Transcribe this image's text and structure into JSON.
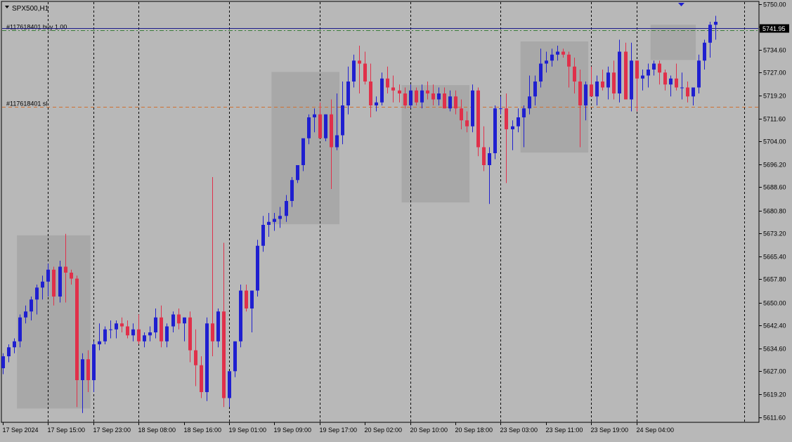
{
  "chart_data": {
    "type": "candlestick",
    "title": "SPX500,H1",
    "ylim": [
      5610.0,
      5751.0
    ],
    "y_ticks": [
      "5750.00",
      "5742.40",
      "5734.60",
      "5727.00",
      "5719.20",
      "5711.60",
      "5704.00",
      "5696.20",
      "5688.60",
      "5680.80",
      "5673.20",
      "5665.40",
      "5657.80",
      "5650.00",
      "5642.40",
      "5634.60",
      "5627.00",
      "5619.20",
      "5611.60"
    ],
    "x_labels": [
      "17 Sep 2024",
      "17 Sep 15:00",
      "17 Sep 23:00",
      "18 Sep 08:00",
      "18 Sep 16:00",
      "19 Sep 01:00",
      "19 Sep 09:00",
      "19 Sep 17:00",
      "20 Sep 02:00",
      "20 Sep 10:00",
      "20 Sep 18:00",
      "23 Sep 03:00",
      "23 Sep 11:00",
      "23 Sep 19:00",
      "24 Sep 04:00"
    ],
    "current_price": "5741.95",
    "order_lines": [
      {
        "label": "#117618401 buy 1.00",
        "price": 5741.1,
        "style": "dash-dot",
        "color": "#3a7d3a"
      },
      {
        "label": "#117618401 sl",
        "price": 5715.6,
        "style": "dashed",
        "color": "#d07030"
      }
    ],
    "bull_color": "#1f1fd0",
    "bear_color": "#e0304a",
    "candles": [
      [
        5628,
        5633,
        5626,
        5632
      ],
      [
        5632,
        5636,
        5630,
        5635
      ],
      [
        5635,
        5638,
        5633,
        5637
      ],
      [
        5637,
        5646,
        5635,
        5645
      ],
      [
        5645,
        5649,
        5643,
        5647
      ],
      [
        5647,
        5652,
        5644,
        5651
      ],
      [
        5651,
        5656,
        5646,
        5655
      ],
      [
        5655,
        5659,
        5651,
        5657
      ],
      [
        5657,
        5663,
        5652,
        5661
      ],
      [
        5661,
        5662,
        5649,
        5652
      ],
      [
        5652,
        5664,
        5650,
        5662
      ],
      [
        5662,
        5673,
        5650,
        5660
      ],
      [
        5660,
        5661,
        5656,
        5658
      ],
      [
        5658,
        5659,
        5615,
        5624
      ],
      [
        5624,
        5633,
        5613,
        5631
      ],
      [
        5631,
        5634,
        5620,
        5624
      ],
      [
        5624,
        5637,
        5620,
        5636
      ],
      [
        5636,
        5643,
        5634,
        5637
      ],
      [
        5637,
        5642,
        5636,
        5641
      ],
      [
        5641,
        5644,
        5638,
        5641
      ],
      [
        5641,
        5644,
        5638,
        5643
      ],
      [
        5643,
        5645,
        5640,
        5642
      ],
      [
        5642,
        5644,
        5638,
        5639
      ],
      [
        5639,
        5643,
        5637,
        5641
      ],
      [
        5641,
        5646,
        5636,
        5637
      ],
      [
        5637,
        5640,
        5635,
        5639
      ],
      [
        5639,
        5642,
        5637,
        5640
      ],
      [
        5640,
        5648,
        5638,
        5645
      ],
      [
        5645,
        5649,
        5635,
        5637
      ],
      [
        5637,
        5643,
        5635,
        5642
      ],
      [
        5642,
        5647,
        5640,
        5646
      ],
      [
        5646,
        5648,
        5641,
        5643
      ],
      [
        5643,
        5645,
        5637,
        5645
      ],
      [
        5645,
        5647,
        5630,
        5634
      ],
      [
        5634,
        5641,
        5622,
        5629
      ],
      [
        5629,
        5632,
        5618,
        5620
      ],
      [
        5620,
        5645,
        5617,
        5643
      ],
      [
        5643,
        5692,
        5632,
        5637
      ],
      [
        5637,
        5648,
        5635,
        5647
      ],
      [
        5647,
        5670,
        5615,
        5618
      ],
      [
        5618,
        5627,
        5615,
        5627
      ],
      [
        5627,
        5637,
        5625,
        5637
      ],
      [
        5637,
        5656,
        5635,
        5654
      ],
      [
        5654,
        5656,
        5647,
        5648
      ],
      [
        5648,
        5650,
        5640,
        5654
      ],
      [
        5654,
        5671,
        5652,
        5669
      ],
      [
        5669,
        5679,
        5667,
        5676
      ],
      [
        5676,
        5680,
        5672,
        5677
      ],
      [
        5677,
        5680,
        5674,
        5678
      ],
      [
        5678,
        5682,
        5675,
        5679
      ],
      [
        5679,
        5686,
        5677,
        5684
      ],
      [
        5684,
        5692,
        5682,
        5691
      ],
      [
        5691,
        5695,
        5690,
        5696
      ],
      [
        5696,
        5704,
        5694,
        5705
      ],
      [
        5705,
        5713,
        5703,
        5712
      ],
      [
        5712,
        5715,
        5707,
        5713
      ],
      [
        5713,
        5717,
        5705,
        5705
      ],
      [
        5705,
        5713,
        5704,
        5713
      ],
      [
        5713,
        5718,
        5688,
        5702
      ],
      [
        5702,
        5720,
        5701,
        5706
      ],
      [
        5706,
        5724,
        5703,
        5716
      ],
      [
        5716,
        5729,
        5713,
        5724
      ],
      [
        5724,
        5733,
        5722,
        5731
      ],
      [
        5731,
        5736,
        5720,
        5730
      ],
      [
        5730,
        5734,
        5723,
        5724
      ],
      [
        5724,
        5730,
        5712,
        5716
      ],
      [
        5716,
        5719,
        5714,
        5717
      ],
      [
        5717,
        5727,
        5716,
        5725
      ],
      [
        5725,
        5729,
        5720,
        5722
      ],
      [
        5722,
        5726,
        5717,
        5721
      ],
      [
        5721,
        5723,
        5717,
        5720
      ],
      [
        5720,
        5722,
        5715,
        5716
      ],
      [
        5716,
        5723,
        5715,
        5721
      ],
      [
        5721,
        5722,
        5716,
        5717
      ],
      [
        5717,
        5723,
        5715,
        5721
      ],
      [
        5721,
        5724,
        5718,
        5720
      ],
      [
        5720,
        5723,
        5716,
        5718
      ],
      [
        5718,
        5722,
        5716,
        5720
      ],
      [
        5720,
        5722,
        5715,
        5715
      ],
      [
        5715,
        5721,
        5714,
        5719
      ],
      [
        5719,
        5721,
        5713,
        5715
      ],
      [
        5715,
        5718,
        5708,
        5711
      ],
      [
        5711,
        5714,
        5707,
        5709
      ],
      [
        5709,
        5723,
        5707,
        5721
      ],
      [
        5721,
        5722,
        5699,
        5702
      ],
      [
        5702,
        5709,
        5694,
        5696
      ],
      [
        5696,
        5702,
        5683,
        5700
      ],
      [
        5700,
        5716,
        5698,
        5715
      ],
      [
        5715,
        5719,
        5713,
        5715
      ],
      [
        5715,
        5720,
        5690,
        5708
      ],
      [
        5708,
        5711,
        5701,
        5709
      ],
      [
        5709,
        5715,
        5707,
        5712
      ],
      [
        5712,
        5716,
        5702,
        5715
      ],
      [
        5715,
        5726,
        5713,
        5719
      ],
      [
        5719,
        5726,
        5716,
        5724
      ],
      [
        5724,
        5735,
        5722,
        5730
      ],
      [
        5730,
        5734,
        5727,
        5731
      ],
      [
        5731,
        5735,
        5729,
        5733
      ],
      [
        5733,
        5736,
        5731,
        5734
      ],
      [
        5734,
        5735,
        5732,
        5733
      ],
      [
        5733,
        5734,
        5722,
        5729
      ],
      [
        5729,
        5732,
        5720,
        5724
      ],
      [
        5724,
        5728,
        5702,
        5716
      ],
      [
        5716,
        5724,
        5711,
        5723
      ],
      [
        5723,
        5729,
        5719,
        5719
      ],
      [
        5719,
        5726,
        5716,
        5724
      ],
      [
        5724,
        5728,
        5721,
        5722
      ],
      [
        5722,
        5729,
        5718,
        5727
      ],
      [
        5727,
        5731,
        5718,
        5720
      ],
      [
        5720,
        5738,
        5717,
        5734
      ],
      [
        5734,
        5737,
        5718,
        5718
      ],
      [
        5718,
        5737,
        5714,
        5731
      ],
      [
        5731,
        5731,
        5714,
        5725
      ],
      [
        5725,
        5728,
        5721,
        5726
      ],
      [
        5726,
        5730,
        5722,
        5728
      ],
      [
        5728,
        5731,
        5726,
        5730
      ],
      [
        5730,
        5731,
        5723,
        5727
      ],
      [
        5727,
        5728,
        5721,
        5723
      ],
      [
        5723,
        5726,
        5719,
        5725
      ],
      [
        5725,
        5730,
        5721,
        5722
      ],
      [
        5722,
        5727,
        5718,
        5722
      ],
      [
        5722,
        5724,
        5717,
        5719
      ],
      [
        5719,
        5722,
        5716,
        5722
      ],
      [
        5722,
        5733,
        5720,
        5731
      ],
      [
        5731,
        5738,
        5728,
        5737
      ],
      [
        5737,
        5744,
        5732,
        5743
      ],
      [
        5743,
        5746,
        5738,
        5744
      ]
    ],
    "highlight_boxes": [
      [
        3,
        15,
        5614.5,
        5672.5
      ],
      [
        48,
        59,
        5676.2,
        5727.2
      ],
      [
        71,
        82,
        5683.5,
        5722.8
      ],
      [
        92,
        103,
        5700.2,
        5737.4
      ],
      [
        115,
        122,
        5731.2,
        5743.0
      ]
    ],
    "sep_index": [
      8,
      16,
      24,
      40,
      56,
      72,
      88,
      104,
      112
    ]
  }
}
